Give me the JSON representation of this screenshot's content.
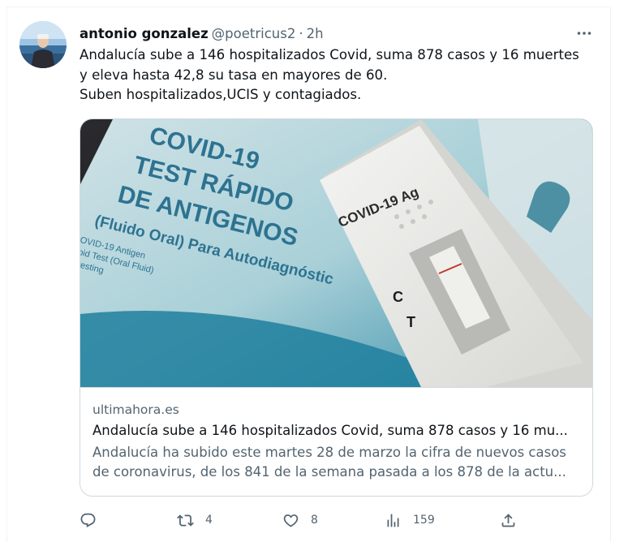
{
  "author": {
    "name": "antonio gonzalez",
    "handle": "@poetricus2",
    "separator": "·",
    "time": "2h"
  },
  "tweet": {
    "lines": [
      "Andalucía sube a 146 hospitalizados Covid, suma 878 casos y 16 muertes",
      "y eleva hasta 42,8 su tasa en mayores de 60.",
      "Suben hospitalizados,UCIS y contagiados."
    ]
  },
  "card": {
    "image_text": {
      "box_line1": "COVID-19",
      "box_line2": "TEST RÁPIDO",
      "box_line3": "DE ANTIGENOS",
      "box_line4": "(Fluido Oral) Para Autodiagnóstic",
      "box_small1": "COVID-19 Antigen",
      "box_small2": "Rapid Test (Oral Fluid)",
      "box_small3": "Self-testing",
      "cassette_label": "COVID-19 Ag",
      "cassette_c": "C",
      "cassette_t": "T"
    },
    "domain": "ultimahora.es",
    "title": "Andalucía sube a 146 hospitalizados Covid, suma 878 casos y 16 mu...",
    "description_lines": [
      "Andalucía ha subido este martes 28 de marzo la cifra de nuevos casos",
      "de coronavirus, de los 841 de la semana pasada a los 878 de la actu..."
    ]
  },
  "actions": {
    "reply_icon": "reply-icon",
    "retweets": "4",
    "likes": "8",
    "views": "159",
    "share_icon": "share-icon"
  }
}
